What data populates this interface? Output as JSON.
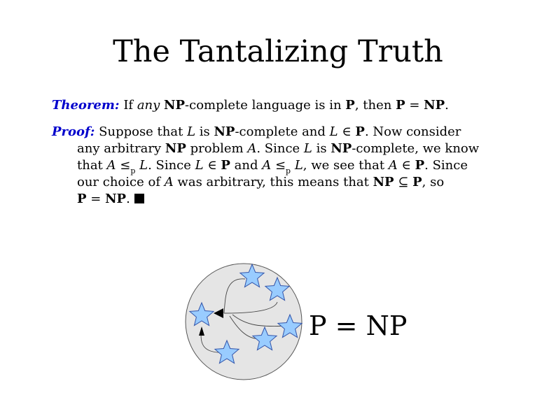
{
  "slide": {
    "title": "The Tantalizing Truth"
  },
  "theorem": {
    "label": "Theorem:",
    "parts": [
      "If ",
      "any",
      " ",
      "NP",
      "-complete language is in ",
      "P",
      ", then ",
      "P",
      " = ",
      "NP",
      "."
    ]
  },
  "proof": {
    "label": "Proof:",
    "line1": [
      " Suppose that ",
      "L",
      " is ",
      "NP",
      "-complete and ",
      "L",
      " ∈ ",
      "P",
      ". Now consider"
    ],
    "line2": [
      "any arbitrary ",
      "NP",
      " problem ",
      "A",
      ". Since ",
      "L",
      " is ",
      "NP",
      "-complete, we know"
    ],
    "line3": [
      "that ",
      "A",
      " ≤",
      "p",
      " ",
      "L",
      ". Since ",
      "L",
      " ∈ ",
      "P",
      " and ",
      "A",
      " ≤",
      "p",
      " ",
      "L",
      ", we see that ",
      "A",
      " ∈ ",
      "P",
      ". Since"
    ],
    "line4": [
      "our choice of ",
      "A",
      " was arbitrary, this means that ",
      "NP",
      " ⊆ ",
      "P",
      ", so"
    ],
    "line5": [
      "P",
      " = ",
      "NP",
      ". "
    ]
  },
  "diagram": {
    "circle_label": "P = NP",
    "colors": {
      "circle_fill": "#e5e5e5",
      "star_fill": "#99ccff",
      "star_stroke": "#3355aa"
    },
    "icons": [
      "star-icon",
      "arrowhead-icon"
    ]
  },
  "colors": {
    "label": "#0000cc",
    "text": "#000000",
    "background": "#ffffff"
  }
}
